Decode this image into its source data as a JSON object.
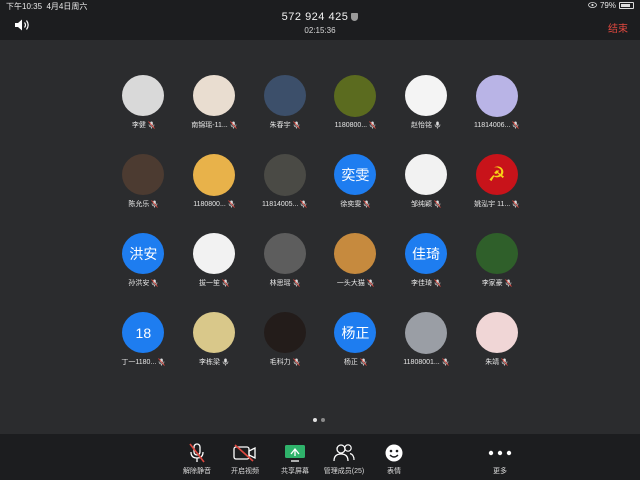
{
  "status": {
    "time": "下午10:35",
    "date": "4月4日周六",
    "battery": "79%"
  },
  "header": {
    "meeting_id": "572 924 425",
    "duration": "02:15:36",
    "end_label": "结束"
  },
  "participants": [
    [
      {
        "name": "李健",
        "avatar": "",
        "bg": "#d9d9d9"
      },
      {
        "name": "南锦瑶-11...",
        "avatar": "",
        "bg": "#e9ddd0"
      },
      {
        "name": "朱春宇",
        "avatar": "",
        "bg": "#3c4f6a"
      },
      {
        "name": "1180800...",
        "avatar": "",
        "bg": "#5b6b1f"
      },
      {
        "name": "赵怡铭",
        "avatar": "",
        "bg": "#f4f4f4"
      },
      {
        "name": "11814006...",
        "avatar": "",
        "bg": "#b9b4e6"
      }
    ],
    [
      {
        "name": "陈允乐",
        "avatar": "",
        "bg": "#4c3b31"
      },
      {
        "name": "1180800...",
        "avatar": "",
        "bg": "#e8b24a"
      },
      {
        "name": "11814005...",
        "avatar": "",
        "bg": "#4a4a45"
      },
      {
        "name": "徐奕雯",
        "avatar": "奕雯",
        "bg": "#1e7df0"
      },
      {
        "name": "邹纯颖",
        "avatar": "",
        "bg": "#f2f2f2"
      },
      {
        "name": "姚泓宇 11...",
        "avatar": "☭",
        "bg": "#c8131a"
      }
    ],
    [
      {
        "name": "孙洪安",
        "avatar": "洪安",
        "bg": "#1e7df0"
      },
      {
        "name": "拔一笙",
        "avatar": "",
        "bg": "#f2f2f2"
      },
      {
        "name": "林思瑶",
        "avatar": "",
        "bg": "#5d5d5d"
      },
      {
        "name": "一头大猫",
        "avatar": "",
        "bg": "#c68a3e"
      },
      {
        "name": "李佳琦",
        "avatar": "佳琦",
        "bg": "#1e7df0"
      },
      {
        "name": "李家豪",
        "avatar": "",
        "bg": "#2f5f2a"
      }
    ],
    [
      {
        "name": "丁一1180...",
        "avatar": "18",
        "bg": "#1e7df0"
      },
      {
        "name": "李栋梁",
        "avatar": "",
        "bg": "#d9c88a"
      },
      {
        "name": "毛科力",
        "avatar": "",
        "bg": "#231c1a"
      },
      {
        "name": "杨正",
        "avatar": "杨正",
        "bg": "#1e7df0"
      },
      {
        "name": "11808001...",
        "avatar": "",
        "bg": "#9a9ea5"
      },
      {
        "name": "朱靖",
        "avatar": "",
        "bg": "#f0d6d6"
      }
    ]
  ],
  "toolbar": {
    "unmute": "解除静音",
    "start_video": "开启视频",
    "share_screen": "共享屏幕",
    "manage_members": "管理成员(25)",
    "emoji": "表情",
    "more": "更多"
  }
}
